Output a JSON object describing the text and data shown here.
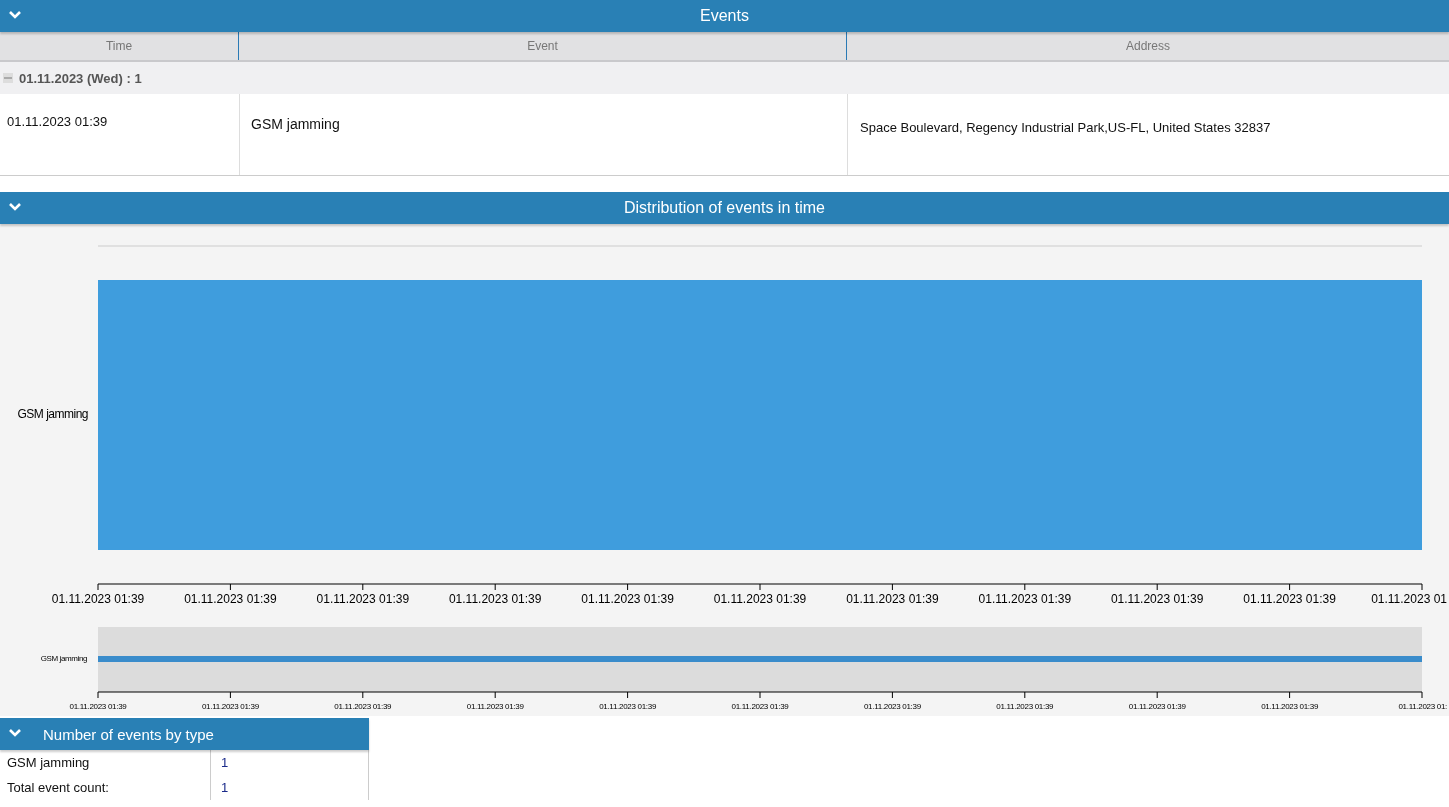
{
  "events_panel": {
    "title": "Events",
    "expanded": true,
    "columns": [
      "Time",
      "Event",
      "Address"
    ],
    "groups": [
      {
        "label": "01.11.2023 (Wed) : 1",
        "expanded": true,
        "rows": [
          {
            "time": "01.11.2023 01:39",
            "event": "GSM jamming",
            "address": "Space Boulevard, Regency Industrial Park,US-FL, United States 32837"
          }
        ]
      }
    ]
  },
  "distribution_panel": {
    "title": "Distribution of events in time",
    "expanded": true,
    "category": "GSM jamming",
    "tick_labels": [
      "01.11.2023 01:39",
      "01.11.2023 01:39",
      "01.11.2023 01:39",
      "01.11.2023 01:39",
      "01.11.2023 01:39",
      "01.11.2023 01:39",
      "01.11.2023 01:39",
      "01.11.2023 01:39",
      "01.11.2023 01:39",
      "01.11.2023 01:39",
      "01.11.2023 01"
    ],
    "overview_category": "GSM jamming",
    "overview_tick_labels": [
      "01.11.2023 01:39",
      "01.11.2023 01:39",
      "01.11.2023 01:39",
      "01.11.2023 01:39",
      "01.11.2023 01:39",
      "01.11.2023 01:39",
      "01.11.2023 01:39",
      "01.11.2023 01:39",
      "01.11.2023 01:39",
      "01.11.2023 01:39",
      "01.11.2023 01:"
    ]
  },
  "count_panel": {
    "title": "Number of events by type",
    "expanded": true,
    "rows": [
      {
        "label": "GSM jamming",
        "value": "1"
      },
      {
        "label": "Total event count:",
        "value": "1"
      }
    ]
  }
}
